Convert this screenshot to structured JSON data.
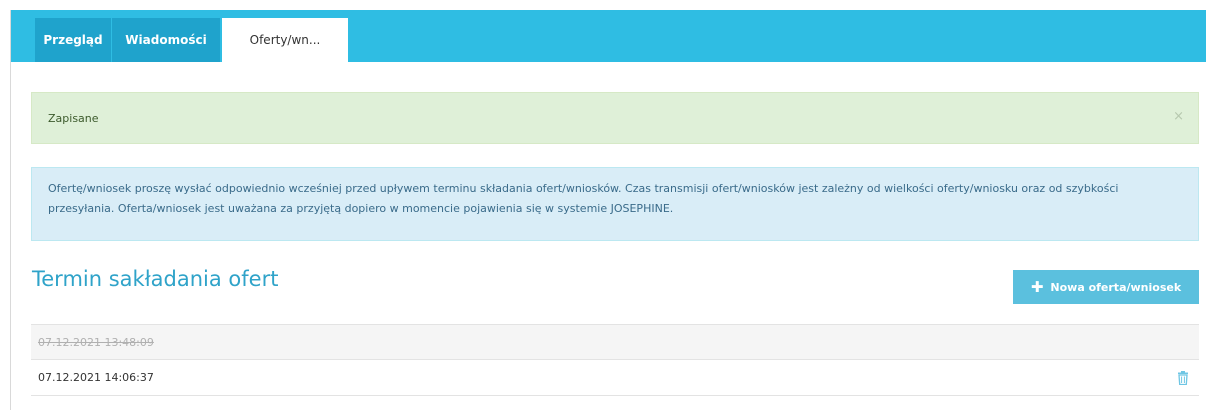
{
  "tabs": [
    {
      "label": "Przegląd"
    },
    {
      "label": "Wiadomości"
    },
    {
      "label": "Oferty/wn..."
    }
  ],
  "alert_success": {
    "message": "Zapisane",
    "close": "×"
  },
  "alert_info": {
    "text": "Ofertę/wniosek proszę wysłać odpowiednio wcześniej przed upływem terminu składania ofert/wniosków. Czas transmisji ofert/wniosków jest zależny od wielkości oferty/wniosku oraz od szybkości przesyłania. Oferta/wniosek jest uważana za przyjętą dopiero w momencie pojawienia się w systemie JOSEPHINE."
  },
  "section": {
    "title": "Termin sakładania ofert",
    "new_button": "Nowa oferta/wniosek",
    "new_button_icon": "plus-icon"
  },
  "submissions": [
    {
      "date": "07.12.2021 13:48:09",
      "deleted": true
    },
    {
      "date": "07.12.2021 14:06:37",
      "deleted": false,
      "icon": "trash-icon"
    }
  ],
  "colors": {
    "accent": "#2fbde3",
    "tab_inactive": "#1fa3cc",
    "success_bg": "#dff0d8",
    "info_bg": "#d9edf7",
    "button": "#5bc0de"
  }
}
